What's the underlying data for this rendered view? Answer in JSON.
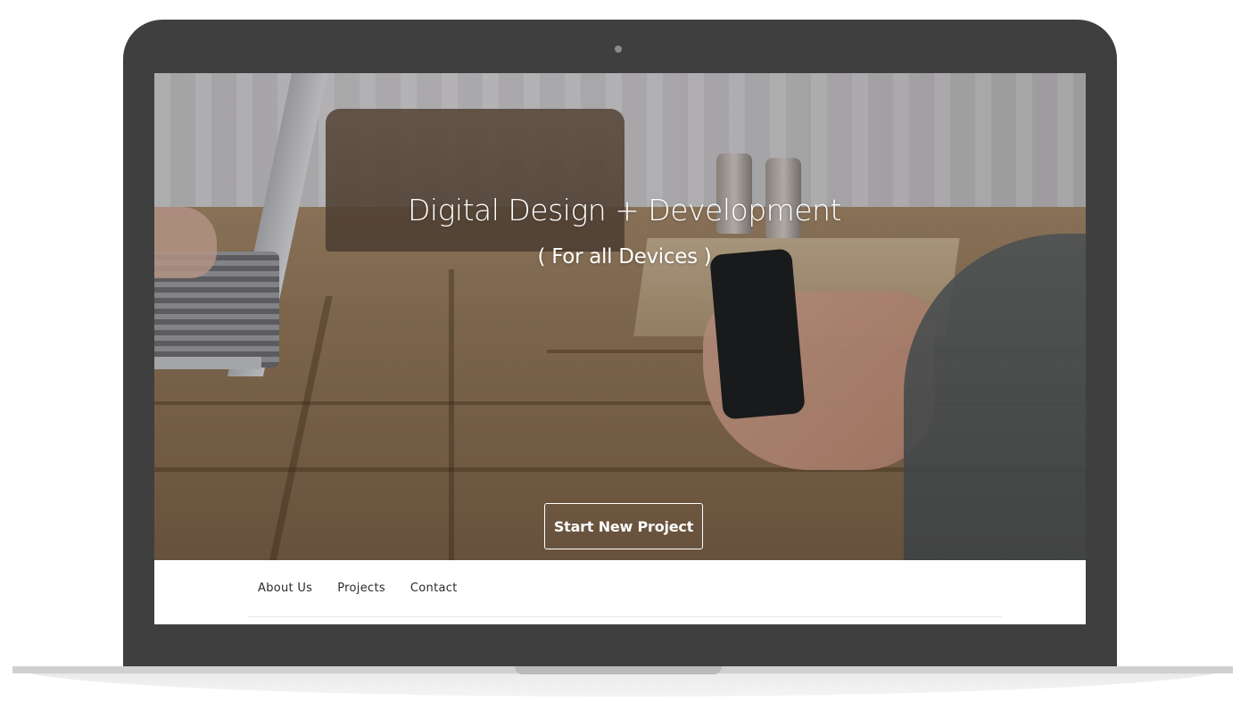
{
  "hero": {
    "title": "Digital Design + Development",
    "subtitle": "( For all Devices )",
    "cta_label": "Start New Project"
  },
  "nav": {
    "items": [
      {
        "label": "About Us"
      },
      {
        "label": "Projects"
      },
      {
        "label": "Contact"
      }
    ]
  },
  "colors": {
    "laptop_frame": "#3f3f3f",
    "nav_text": "#2a2a2a",
    "hero_text": "#ffffff"
  }
}
